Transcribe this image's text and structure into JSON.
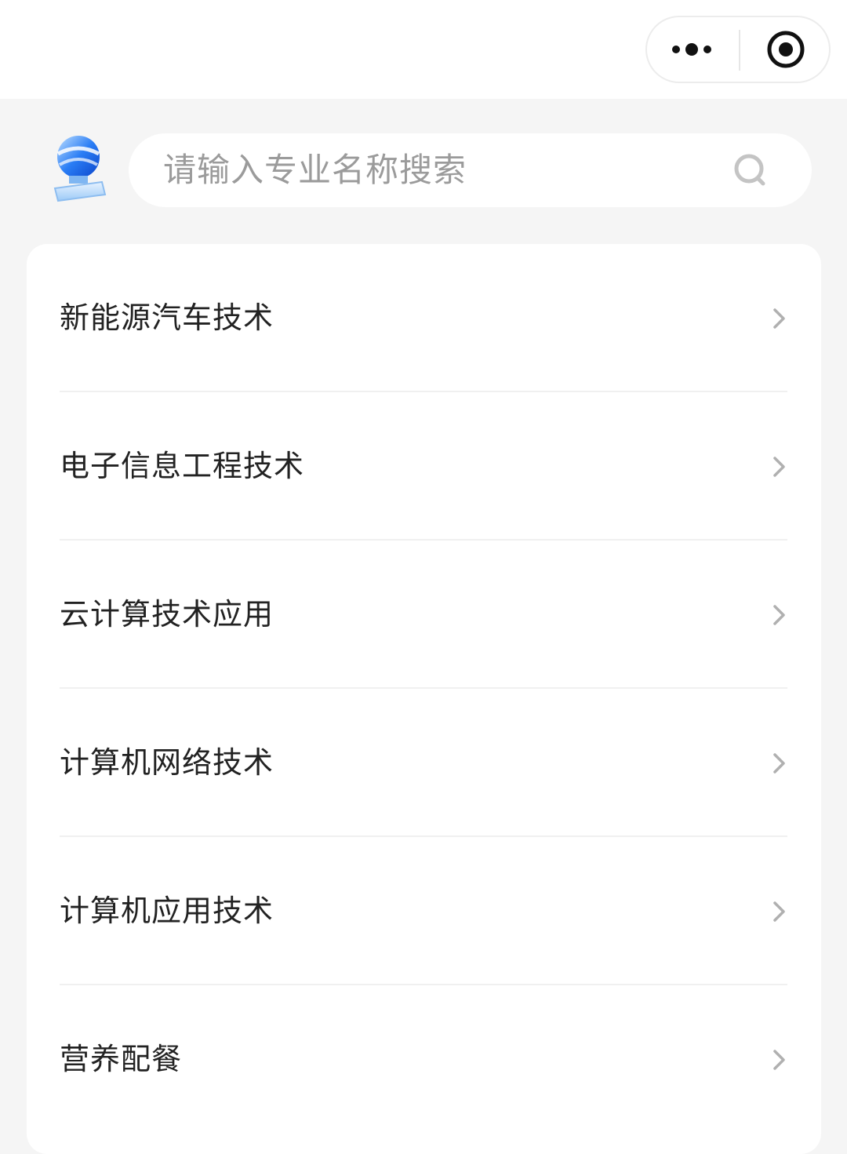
{
  "capsule": {
    "more_icon": "more-dots-icon",
    "close_icon": "target-circle-icon"
  },
  "search": {
    "placeholder": "请输入专业名称搜索",
    "icon": "search-icon"
  },
  "logo": {
    "icon": "app-logo-icon"
  },
  "majors": [
    {
      "label": "新能源汽车技术"
    },
    {
      "label": "电子信息工程技术"
    },
    {
      "label": "云计算技术应用"
    },
    {
      "label": "计算机网络技术"
    },
    {
      "label": "计算机应用技术"
    },
    {
      "label": "营养配餐"
    }
  ],
  "colors": {
    "background": "#f5f5f5",
    "card": "#ffffff",
    "text": "#222222",
    "placeholder": "#9b9b9b",
    "chevron": "#b0b0b0",
    "accent": "#1a6cf0"
  }
}
